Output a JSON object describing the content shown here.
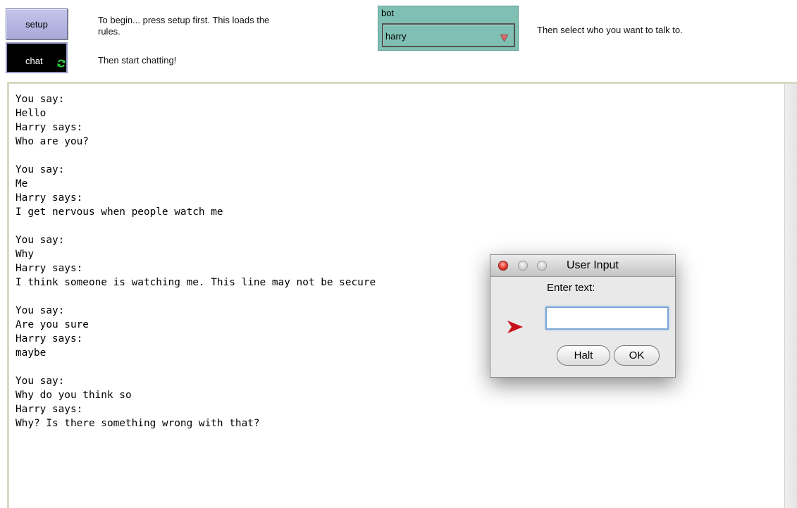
{
  "buttons": {
    "setup_label": "setup",
    "chat_label": "chat"
  },
  "instructions": {
    "setup_line1": "To begin... press setup first. This loads the",
    "setup_line2": "rules.",
    "chat": "Then start chatting!",
    "select": "Then select who you want to talk to."
  },
  "bot_chooser": {
    "label": "bot",
    "selected": "harry"
  },
  "transcript": [
    "You say:",
    "Hello",
    "Harry says:",
    "Who are you?",
    "",
    "You say:",
    "Me",
    "Harry says:",
    "I get nervous when people watch me",
    "",
    "You say:",
    "Why",
    "Harry says:",
    "I think someone is watching me. This line may not be secure",
    "",
    "You say:",
    "Are you sure",
    "Harry says:",
    "maybe",
    "",
    "You say:",
    "Why do you think so",
    "Harry says:",
    "Why? Is there something wrong with that?"
  ],
  "dialog": {
    "title": "User Input",
    "prompt": "Enter text:",
    "input_value": "",
    "halt_label": "Halt",
    "ok_label": "OK"
  },
  "colors": {
    "button_face": "#b6b6e4",
    "chooser_bg": "#7fbfb4",
    "dropdown_arrow": "#e06b6b",
    "forever_icon": "#2ecc40",
    "pointer_arrow": "#c8111a"
  },
  "icons": {
    "forever": "forever-icon",
    "dropdown": "dropdown-arrow-icon",
    "pointer": "red-arrow-icon"
  }
}
